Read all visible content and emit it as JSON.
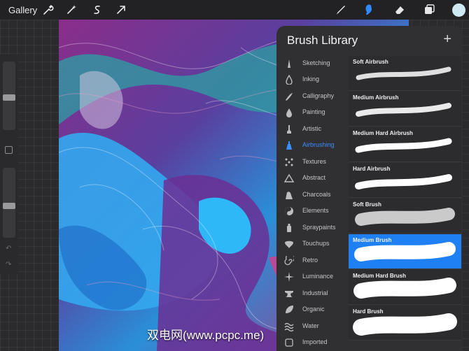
{
  "topbar": {
    "gallery_label": "Gallery",
    "tool_icons": [
      "wrench-icon",
      "magic-wand-icon",
      "selection-icon",
      "transform-arrow-icon"
    ],
    "right_icons": [
      "brush-icon",
      "smudge-icon",
      "eraser-icon",
      "layers-icon"
    ],
    "active_tool": "smudge",
    "current_color": "#cfe9f2"
  },
  "panel": {
    "title": "Brush Library",
    "add_label": "+",
    "categories": [
      {
        "label": "Sketching",
        "icon": "pencil-icon"
      },
      {
        "label": "Inking",
        "icon": "ink-drop-icon"
      },
      {
        "label": "Calligraphy",
        "icon": "calligraphy-icon"
      },
      {
        "label": "Painting",
        "icon": "paint-drop-icon"
      },
      {
        "label": "Artistic",
        "icon": "artistic-brush-icon"
      },
      {
        "label": "Airbrushing",
        "icon": "airbrush-icon",
        "active": true
      },
      {
        "label": "Textures",
        "icon": "texture-icon"
      },
      {
        "label": "Abstract",
        "icon": "triangle-icon"
      },
      {
        "label": "Charcoals",
        "icon": "charcoal-icon"
      },
      {
        "label": "Elements",
        "icon": "yin-yang-icon"
      },
      {
        "label": "Spraypaints",
        "icon": "spray-can-icon"
      },
      {
        "label": "Touchups",
        "icon": "touchup-icon"
      },
      {
        "label": "Retro",
        "icon": "retro-swirl-icon"
      },
      {
        "label": "Luminance",
        "icon": "sparkle-icon"
      },
      {
        "label": "Industrial",
        "icon": "anvil-icon"
      },
      {
        "label": "Organic",
        "icon": "leaf-icon"
      },
      {
        "label": "Water",
        "icon": "waves-icon"
      },
      {
        "label": "Imported",
        "icon": "imported-icon"
      }
    ],
    "brushes": [
      {
        "name": "Soft Airbrush"
      },
      {
        "name": "Medium Airbrush"
      },
      {
        "name": "Medium Hard Airbrush"
      },
      {
        "name": "Hard Airbrush"
      },
      {
        "name": "Soft Brush"
      },
      {
        "name": "Medium Brush",
        "selected": true
      },
      {
        "name": "Medium Hard Brush"
      },
      {
        "name": "Hard Brush"
      }
    ]
  },
  "watermark": "双电网(www.pcpc.me)",
  "colors": {
    "accent": "#1f80f4",
    "panel": "#303033",
    "toolbar": "#222224"
  }
}
